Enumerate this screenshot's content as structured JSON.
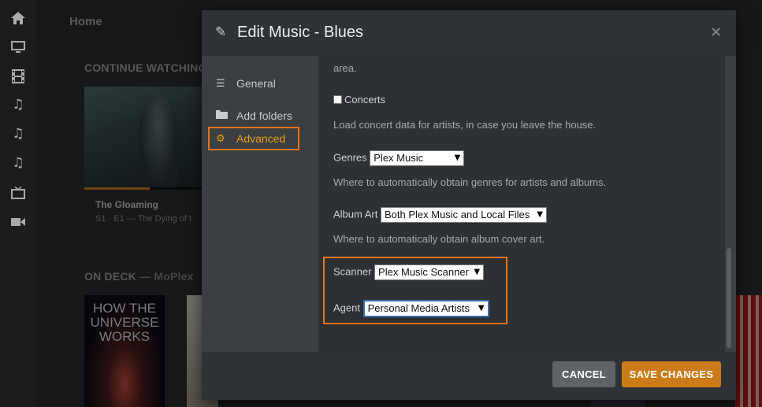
{
  "rail": {
    "icons": [
      "home-icon",
      "monitor-icon",
      "film-icon",
      "music-icon",
      "music-icon",
      "music-icon",
      "tv-icon",
      "video-camera-icon"
    ]
  },
  "background": {
    "breadcrumb": "Home",
    "continue_watching": {
      "heading": "CONTINUE WATCHING",
      "item_title": "The Gloaming",
      "item_subtitle": "S1 · E1 — The Dying of t",
      "progress": 0.55
    },
    "on_deck": {
      "heading": "ON DECK",
      "server": "MoPlex",
      "poster_text": "HOW THE UNIVERSE WORKS"
    }
  },
  "modal": {
    "title": "Edit Music - Blues",
    "close_symbol": "×",
    "sidebar": [
      {
        "label": "General",
        "icon": "list-icon"
      },
      {
        "label": "Add folders",
        "icon": "folder-icon"
      },
      {
        "label": "Advanced",
        "icon": "gear-icon",
        "active": true
      }
    ],
    "content": {
      "area_text": "area.",
      "concerts_label": "Concerts",
      "concerts_checked": false,
      "concerts_help": "Load concert data for artists, in case you leave the house.",
      "genres_label": "Genres",
      "genres_value": "Plex Music",
      "genres_help": "Where to automatically obtain genres for artists and albums.",
      "album_art_label": "Album Art",
      "album_art_value": "Both Plex Music and Local Files",
      "album_art_help": "Where to automatically obtain album cover art.",
      "scanner_label": "Scanner",
      "scanner_value": "Plex Music Scanner",
      "agent_label": "Agent",
      "agent_value": "Personal Media Artists"
    },
    "buttons": {
      "cancel": "CANCEL",
      "save": "SAVE CHANGES"
    }
  },
  "colors": {
    "accent": "#e5a00d",
    "highlight": "#e5731b",
    "save_button": "#cc7b19"
  }
}
